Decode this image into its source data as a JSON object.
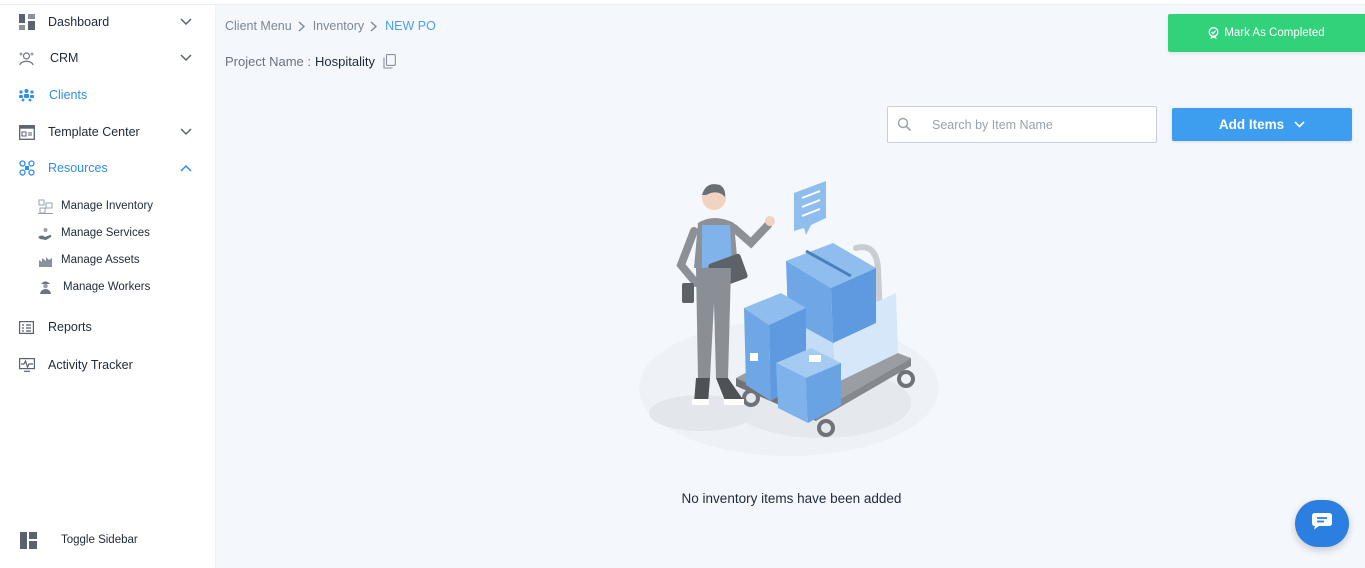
{
  "sidebar": {
    "items": [
      {
        "label": "Dashboard",
        "icon": "dashboard-icon"
      },
      {
        "label": "CRM",
        "icon": "crm-icon"
      },
      {
        "label": "Clients",
        "icon": "clients-icon"
      },
      {
        "label": "Template Center",
        "icon": "template-icon"
      },
      {
        "label": "Resources",
        "icon": "resources-icon"
      }
    ],
    "sub_items": [
      {
        "label": "Manage Inventory",
        "icon": "inventory-icon"
      },
      {
        "label": "Manage Services",
        "icon": "services-icon"
      },
      {
        "label": "Manage Assets",
        "icon": "assets-icon"
      },
      {
        "label": "Manage Workers",
        "icon": "workers-icon"
      }
    ],
    "bottom_items": [
      {
        "label": "Reports",
        "icon": "reports-icon"
      },
      {
        "label": "Activity Tracker",
        "icon": "activity-icon"
      }
    ],
    "toggle_label": "Toggle Sidebar"
  },
  "breadcrumb": [
    "Client Menu",
    "Inventory",
    "NEW PO"
  ],
  "project": {
    "label": "Project Name :",
    "value": "Hospitality"
  },
  "actions": {
    "mark_completed": "Mark As Completed",
    "add_items": "Add Items"
  },
  "search": {
    "placeholder": "Search by Item Name",
    "value": ""
  },
  "empty_state": {
    "message": "No inventory items have been added"
  },
  "colors": {
    "accent": "#3d9ef0",
    "success": "#32d27a",
    "active_nav": "#2f8ee9",
    "main_bg": "#f4f8fd"
  }
}
